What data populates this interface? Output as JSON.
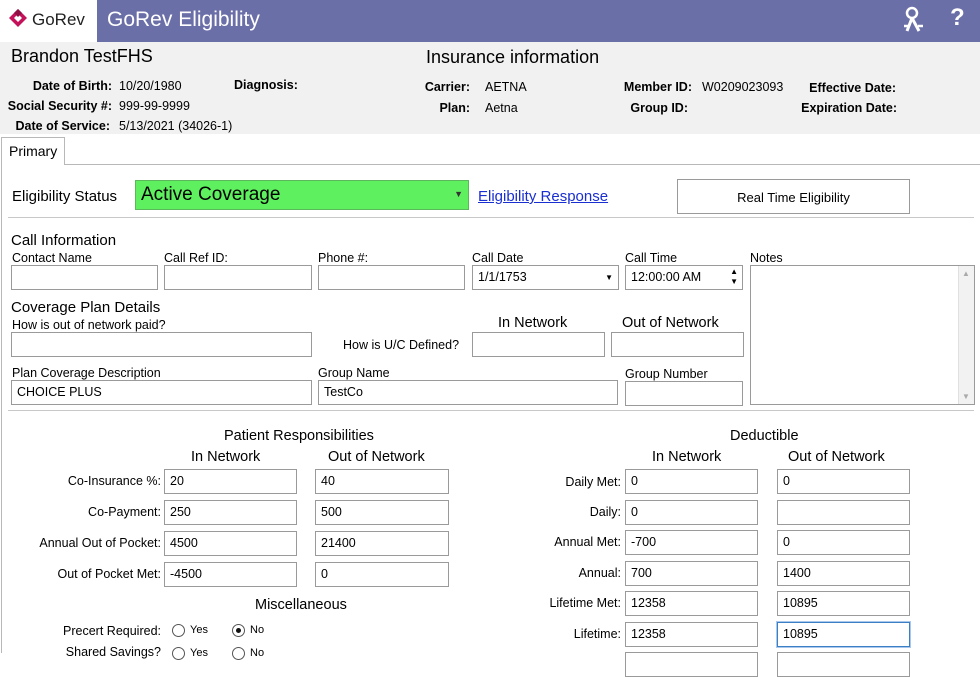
{
  "app": {
    "logo_text": "GoRev",
    "title": "GoRev Eligibility",
    "help_label": "?",
    "logo_color": "#c4125a",
    "title_bar_color": "#6b6fa8"
  },
  "patient": {
    "name": "Brandon TestFHS",
    "dob_label": "Date of Birth:",
    "dob": "10/20/1980",
    "ssn_label": "Social Security #:",
    "ssn": "999-99-9999",
    "dos_label": "Date of Service:",
    "dos": "5/13/2021 (34026-1)",
    "diagnosis_label": "Diagnosis:"
  },
  "insurance": {
    "heading": "Insurance information",
    "carrier_label": "Carrier:",
    "carrier": "AETNA",
    "plan_label": "Plan:",
    "plan": "Aetna",
    "member_id_label": "Member ID:",
    "member_id": "W0209023093",
    "group_id_label": "Group ID:",
    "effective_date_label": "Effective Date:",
    "expiration_date_label": "Expiration Date:"
  },
  "tabs": [
    {
      "label": "Primary"
    }
  ],
  "eligibility": {
    "status_label": "Eligibility Status",
    "status_value": "Active Coverage",
    "status_color": "#5ef05e",
    "response_link": "Eligibility Response",
    "rte_button": "Real Time Eligibility"
  },
  "call_info": {
    "heading": "Call Information",
    "contact_name_label": "Contact Name",
    "contact_name": "",
    "call_ref_label": "Call Ref ID:",
    "call_ref": "",
    "phone_label": "Phone #:",
    "phone": "",
    "call_date_label": "Call Date",
    "call_date": "1/1/1753",
    "call_time_label": "Call Time",
    "call_time": "12:00:00 AM",
    "notes_label": "Notes",
    "notes": ""
  },
  "coverage": {
    "heading": "Coverage Plan Details",
    "oon_paid_label": "How is out of network paid?",
    "oon_paid": "",
    "in_network_label": "In Network",
    "out_network_label": "Out of Network",
    "uc_defined_label": "How is U/C Defined?",
    "uc_in": "",
    "uc_out": "",
    "plan_desc_label": "Plan Coverage Description",
    "plan_desc": "CHOICE PLUS",
    "group_name_label": "Group Name",
    "group_name": "TestCo",
    "group_number_label": "Group Number",
    "group_number": ""
  },
  "patient_resp": {
    "heading": "Patient Responsibilities",
    "in_label": "In Network",
    "out_label": "Out of Network",
    "rows": [
      {
        "label": "Co-Insurance %:",
        "in": "20",
        "out": "40"
      },
      {
        "label": "Co-Payment:",
        "in": "250",
        "out": "500"
      },
      {
        "label": "Annual Out of Pocket:",
        "in": "4500",
        "out": "21400"
      },
      {
        "label": "Out of Pocket Met:",
        "in": "-4500",
        "out": "0"
      }
    ]
  },
  "deductible": {
    "heading": "Deductible",
    "in_label": "In Network",
    "out_label": "Out of Network",
    "rows": [
      {
        "label": "Daily Met:",
        "in": "0",
        "out": "0"
      },
      {
        "label": "Daily:",
        "in": "0",
        "out": ""
      },
      {
        "label": "Annual Met:",
        "in": "-700",
        "out": "0"
      },
      {
        "label": "Annual:",
        "in": "700",
        "out": "1400"
      },
      {
        "label": "Lifetime Met:",
        "in": "12358",
        "out": "10895"
      },
      {
        "label": "Lifetime:",
        "in": "12358",
        "out": "10895"
      }
    ]
  },
  "misc": {
    "heading": "Miscellaneous",
    "precert_label": "Precert Required:",
    "yes_label": "Yes",
    "no_label": "No",
    "precert_selected": "No",
    "shared_savings_label": "Shared Savings?"
  }
}
